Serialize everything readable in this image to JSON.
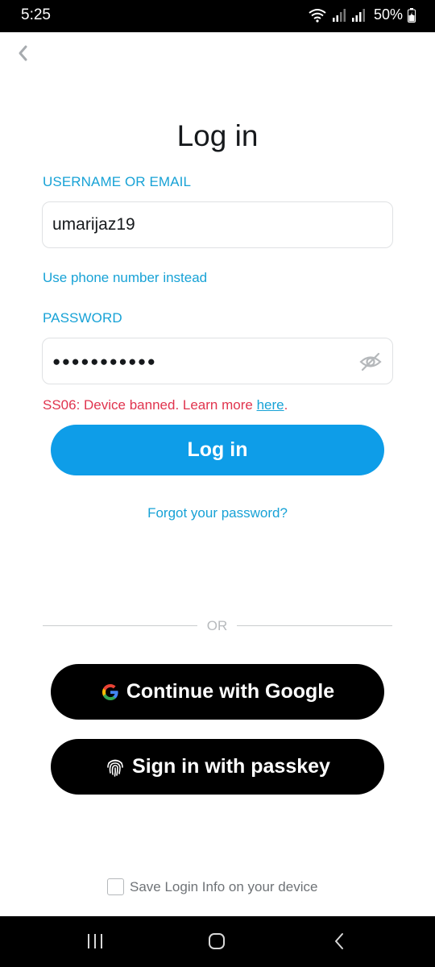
{
  "status_bar": {
    "time": "5:25",
    "battery": "50%"
  },
  "page": {
    "title": "Log in"
  },
  "username": {
    "label": "USERNAME OR EMAIL",
    "value": "umarijaz19"
  },
  "phone_link": "Use phone number instead",
  "password": {
    "label": "PASSWORD",
    "masked_value": "●●●●●●●●●●●"
  },
  "error": {
    "text": "SS06: Device banned. Learn more ",
    "link": "here",
    "suffix": "."
  },
  "login_button": "Log in",
  "forgot_link": "Forgot your password?",
  "divider_text": "OR",
  "google_button": "Continue with Google",
  "passkey_button": "Sign in with passkey",
  "save_login_label": "Save Login Info on your device",
  "colors": {
    "accent": "#17a2d6",
    "primary_button": "#0e9de8",
    "error": "#e0344e"
  },
  "icons": {
    "back": "chevron-left-icon",
    "eye": "eye-off-icon",
    "google": "google-logo-icon",
    "passkey": "fingerprint-icon"
  }
}
